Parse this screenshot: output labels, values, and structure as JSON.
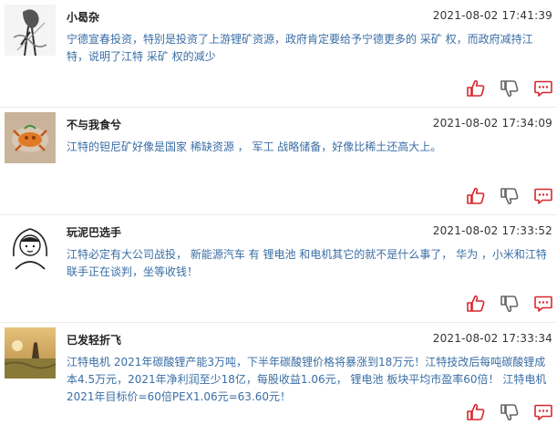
{
  "colors": {
    "accent": "#d9272e",
    "text_blue": "#3a6ea5",
    "divider": "#ececec"
  },
  "comments": [
    {
      "username": "小曷杂",
      "timestamp": "2021-08-02 17:41:39",
      "text": "宁德宣春投资，特别是投资了上游锂矿资源，政府肯定要给予宁德更多的 采矿 权，而政府减持江特，说明了江特 采矿 权的减少",
      "avatar": "sketch-woman-avatar"
    },
    {
      "username": "不与我食兮",
      "timestamp": "2021-08-02 17:34:09",
      "text": "江特的钽尼矿好像是国家 稀缺资源 ， 军工 战略储备，好像比稀土还高大上。",
      "avatar": "crab-dish-avatar"
    },
    {
      "username": "玩泥巴选手",
      "timestamp": "2021-08-02 17:33:52",
      "text": "江特必定有大公司战投， 新能源汽车 有 锂电池 和电机其它的就不是什么事了， 华为 ，小米和江特联手正在谈判，坐等收钱！",
      "avatar": "cartoon-girl-avatar"
    },
    {
      "username": "已发轻折飞",
      "timestamp": "2021-08-02 17:33:34",
      "text": "江特电机 2021年碳酸锂产能3万吨，下半年碳酸锂价格将暴涨到18万元！江特技改后每吨碳酸锂成本4.5万元，2021年净利润至少18亿，每股收益1.06元， 锂电池 板块平均市盈率60倍！ 江特电机 2021年目标价=60倍PEX1.06元=63.60元！",
      "avatar": "sunset-field-avatar"
    }
  ],
  "actions": {
    "like_icon": "thumbs-up-icon",
    "dislike_icon": "thumbs-down-icon",
    "reply_icon": "comment-icon"
  }
}
